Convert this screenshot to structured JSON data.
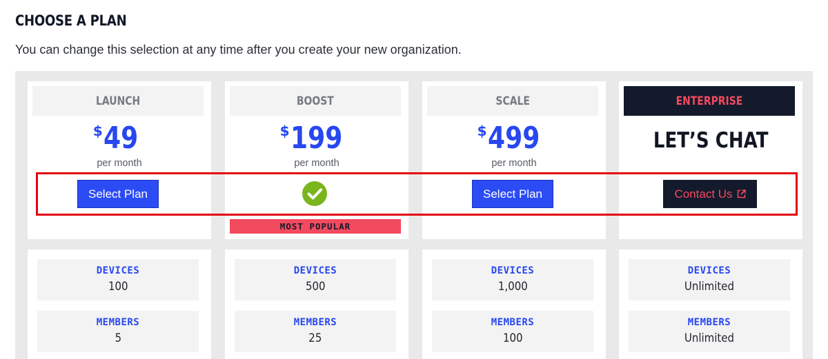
{
  "page": {
    "title": "CHOOSE A PLAN",
    "subtitle": "You can change this selection at any time after you create your new organization."
  },
  "plans": [
    {
      "name": "LAUNCH",
      "currency": "$",
      "price": "49",
      "period": "per month",
      "action_label": "Select Plan"
    },
    {
      "name": "BOOST",
      "currency": "$",
      "price": "199",
      "period": "per month",
      "selected_icon": "check-circle-icon",
      "badge": "MOST POPULAR"
    },
    {
      "name": "SCALE",
      "currency": "$",
      "price": "499",
      "period": "per month",
      "action_label": "Select Plan"
    },
    {
      "name": "ENTERPRISE",
      "headline": "LET’S CHAT",
      "action_label": "Contact Us",
      "action_icon": "external-link-icon"
    }
  ],
  "features": [
    {
      "devices_label": "DEVICES",
      "devices": "100",
      "members_label": "MEMBERS",
      "members": "5"
    },
    {
      "devices_label": "DEVICES",
      "devices": "500",
      "members_label": "MEMBERS",
      "members": "25"
    },
    {
      "devices_label": "DEVICES",
      "devices": "1,000",
      "members_label": "MEMBERS",
      "members": "100"
    },
    {
      "devices_label": "DEVICES",
      "devices": "Unlimited",
      "members_label": "MEMBERS",
      "members": "Unlimited"
    }
  ],
  "colors": {
    "accent_blue": "#2b4cf5",
    "accent_red": "#f24a5f",
    "dark_navy": "#131a2c",
    "check_green": "#7ab51d",
    "highlight_red": "#e3000f"
  }
}
